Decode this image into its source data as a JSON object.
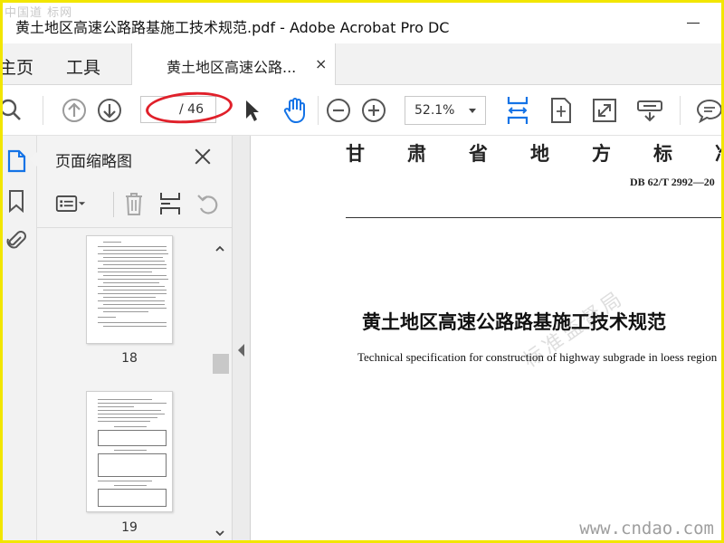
{
  "window": {
    "title": "黄土地区高速公路路基施工技术规范.pdf - Adobe Acrobat Pro DC",
    "overlay_watermark": "中国道 标网"
  },
  "tabs": {
    "home": "主页",
    "tools": "工具",
    "document": "黄土地区高速公路...",
    "close_glyph": "×"
  },
  "toolbar": {
    "page_current": "",
    "page_total": "/ 46",
    "zoom": "52.1%",
    "icons": [
      "search-icon",
      "previous-page-icon",
      "next-page-icon",
      "select-arrow-icon",
      "hand-icon",
      "zoom-out-icon",
      "zoom-in-icon",
      "fit-width-icon",
      "fit-page-icon",
      "fullscreen-icon",
      "read-mode-icon",
      "comment-icon"
    ],
    "accent_color": "#1473e6",
    "annotation_color": "#e0202a"
  },
  "rail": {
    "icons": [
      "page-thumbnails-icon",
      "bookmark-icon",
      "attachment-icon"
    ]
  },
  "thumbnails_panel": {
    "title": "页面缩略图",
    "tools": [
      "options-menu-icon",
      "delete-icon",
      "insert-page-icon",
      "undo-icon"
    ],
    "pages": [
      {
        "number": "18"
      },
      {
        "number": "19"
      }
    ]
  },
  "document": {
    "header_text": "甘肃省地方标准",
    "standard_number": "DB 62/T 2992—20",
    "title_cn": "黄土地区高速公路路基施工技术规范",
    "title_en": "Technical specification for construction of highway subgrade in loess region",
    "stamp_text": "标准监督局"
  },
  "watermarks": {
    "bottom_right": "www.cndao.com"
  }
}
